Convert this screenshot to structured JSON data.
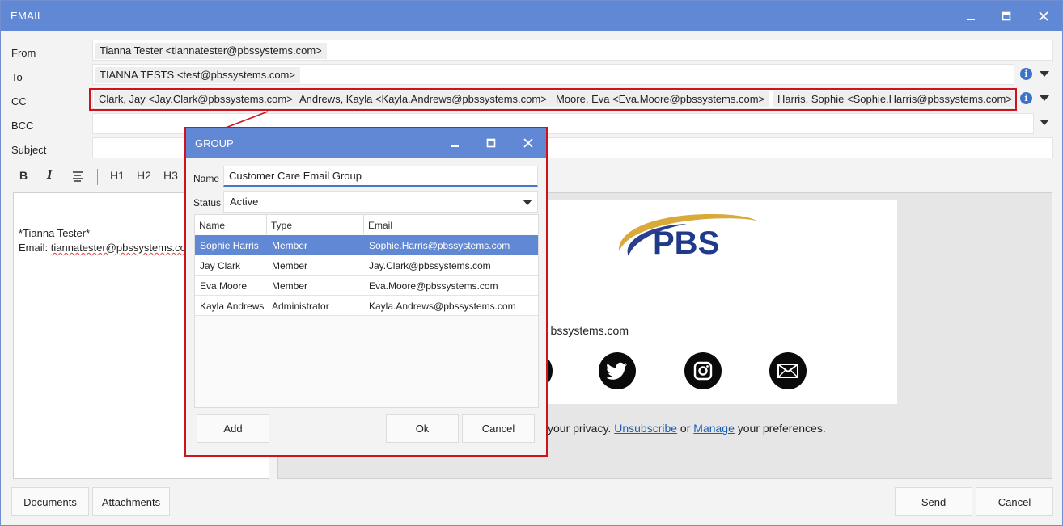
{
  "window": {
    "title": "EMAIL"
  },
  "fields": {
    "from_label": "From",
    "to_label": "To",
    "cc_label": "CC",
    "bcc_label": "BCC",
    "subject_label": "Subject",
    "from": [
      "Tianna Tester <tiannatester@pbssystems.com>"
    ],
    "to": [
      "TIANNA TESTS <test@pbssystems.com>"
    ],
    "cc": [
      "Clark, Jay <Jay.Clark@pbssystems.com>",
      "Andrews, Kayla <Kayla.Andrews@pbssystems.com>",
      "Moore, Eva <Eva.Moore@pbssystems.com>",
      "Harris, Sophie <Sophie.Harris@pbssystems.com>"
    ],
    "subject": ""
  },
  "toolbar": {
    "bold": "B",
    "italic": "I",
    "h1": "H1",
    "h2": "H2",
    "h3": "H3"
  },
  "editor": {
    "line1": "*Tianna Tester*",
    "email_prefix": "Email: ",
    "email_value": "tiannatester@pbssystems.co"
  },
  "preview": {
    "logo_text": "PBS",
    "email_fragment": "bssystems.com",
    "footer_prefix": "your privacy. ",
    "unsubscribe": "Unsubscribe",
    "footer_or": " or ",
    "manage": "Manage",
    "footer_suffix": " your preferences."
  },
  "bottom": {
    "documents": "Documents",
    "attachments": "Attachments",
    "send": "Send",
    "cancel": "Cancel"
  },
  "group": {
    "title": "GROUP",
    "name_label": "Name",
    "name_value": "Customer Care Email Group",
    "status_label": "Status",
    "status_value": "Active",
    "columns": [
      "Name",
      "Type",
      "Email"
    ],
    "rows": [
      {
        "name": "Sophie Harris",
        "type": "Member",
        "email": "Sophie.Harris@pbssystems.com"
      },
      {
        "name": "Jay Clark",
        "type": "Member",
        "email": "Jay.Clark@pbssystems.com"
      },
      {
        "name": "Eva Moore",
        "type": "Member",
        "email": "Eva.Moore@pbssystems.com"
      },
      {
        "name": "Kayla Andrews",
        "type": "Administrator",
        "email": "Kayla.Andrews@pbssystems.com"
      }
    ],
    "add": "Add",
    "ok": "Ok",
    "cancel": "Cancel"
  },
  "colors": {
    "accent": "#6188d4",
    "highlight": "#d0121b",
    "link": "#1a5fb4"
  }
}
